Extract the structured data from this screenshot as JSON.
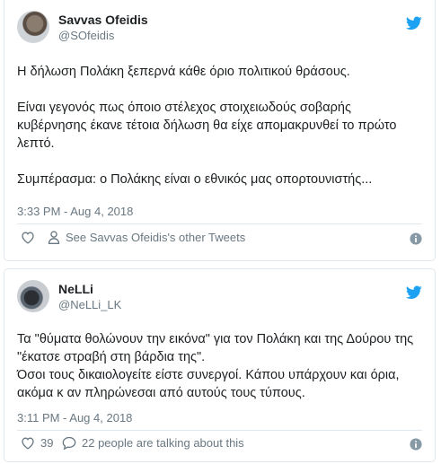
{
  "tweets": [
    {
      "name": "Savvas Ofeidis",
      "handle": "@SOfeidis",
      "text": [
        "Η δήλωση Πολάκη ξεπερνά κάθε όριο πολιτικού θράσους.",
        "",
        "Είναι γεγονός πως όποιο στέλεχος στοιχειωδούς σοβαρής",
        "κυβέρνησης έκανε τέτοια δήλωση θα είχε απομακρυνθεί το πρώτο",
        "λεπτό.",
        "",
        "Συμπέρασμα: ο Πολάκης είναι ο εθνικός μας οπορτουνιστής..."
      ],
      "time": "3:33 PM - Aug 4, 2018",
      "action_text": "See Savvas Ofeidis's other Tweets"
    },
    {
      "name": "NeLLi",
      "handle": "@NeLLi_LK",
      "text": [
        "Τα \"θύματα θολώνουν την εικόνα\" για τον Πολάκη και της Δούρου της",
        "\"έκατσε στραβή στη βάρδια της\".",
        "Όσοι τους δικαιολογείτε είστε συνεργοί. Κάπου υπάρχουν και όρια,",
        "ακόμα κ αν πληρώνεσαι από αυτούς τους τύπους."
      ],
      "time": "3:11 PM - Aug 4, 2018",
      "likes": "39",
      "action_text": "22 people are talking about this"
    }
  ],
  "colors": {
    "twitter_blue": "#1da1f2",
    "muted": "#697882",
    "border": "#e1e8ed"
  },
  "icons": [
    "twitter-bird-icon",
    "heart-icon",
    "user-icon",
    "comment-icon",
    "info-icon"
  ]
}
